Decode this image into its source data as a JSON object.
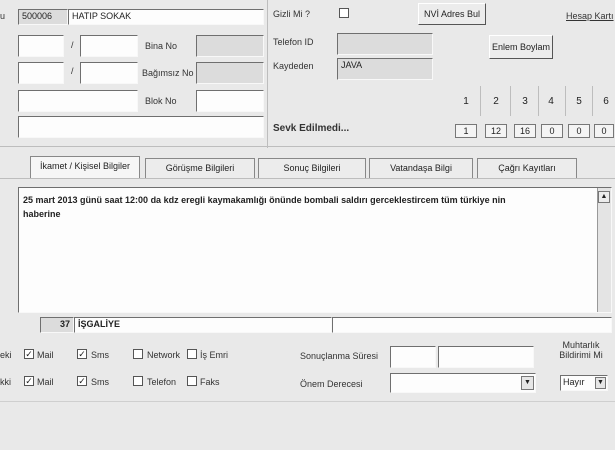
{
  "top": {
    "left_edge_label": "u",
    "code": "500006",
    "street": "HATIP SOKAK",
    "slash1": "/",
    "slash2": "/",
    "bina_no_label": "Bina No",
    "bagimsiz_no_label": "Bağımsız No",
    "blok_no_label": "Blok No",
    "gizli_label": "Gizli Mi ?",
    "nvi_button": "NVİ Adres Bul",
    "hesap_kart_label": "Hesap Kartı",
    "telefon_id_label": "Telefon ID",
    "enlem_button": "Enlem Boylam",
    "kaydeden_label": "Kaydeden",
    "kaydeden_value": "JAVA",
    "sevk_label": "Sevk Edilmedi...",
    "numbers": [
      "1",
      "2",
      "3",
      "4",
      "5",
      "6"
    ],
    "number_values": [
      "1",
      "12",
      "16",
      "0",
      "0",
      "0"
    ]
  },
  "tabs": [
    {
      "label": "İkamet / Kişisel Bilgiler"
    },
    {
      "label": "Görüşme Bilgileri"
    },
    {
      "label": "Sonuç Bilgileri"
    },
    {
      "label": "Vatandaşa Bilgi"
    },
    {
      "label": "Çağrı Kayıtları"
    }
  ],
  "message": {
    "line1": "25 mart 2013 günü saat 12:00 da kdz eregli kaymakamlığı önünde bombali saldırı gerceklestircem tüm türkiye nin",
    "line2": "haberine"
  },
  "status": {
    "code": "37",
    "text": "İŞGALİYE"
  },
  "notify": {
    "row1_edge": "eki",
    "row2_edge": "kki",
    "row1": [
      {
        "label": "Mail",
        "checked": "✓"
      },
      {
        "label": "Sms",
        "checked": "✓"
      },
      {
        "label": "Network",
        "checked": ""
      },
      {
        "label": "İş Emri",
        "checked": ""
      }
    ],
    "row2": [
      {
        "label": "Mail",
        "checked": "✓"
      },
      {
        "label": "Sms",
        "checked": "✓"
      },
      {
        "label": "Telefon",
        "checked": ""
      },
      {
        "label": "Faks",
        "checked": ""
      }
    ],
    "sonuclanma_label": "Sonuçlanma Süresi",
    "onem_label": "Önem Derecesi",
    "muhtarlik_label": "Muhtarlık Bildirimi Mi",
    "muhtarlik_value": "Hayır"
  }
}
